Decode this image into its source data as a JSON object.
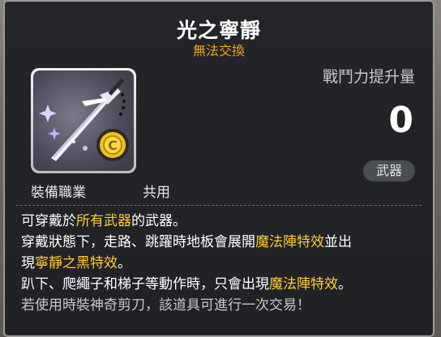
{
  "item": {
    "name": "光之寧靜",
    "trade_status": "無法交換",
    "power_label": "戰鬥力提升量",
    "power_value": "0",
    "category": "武器",
    "job_label": "裝備職業",
    "job_value": "共用",
    "icon": "sword-icon"
  },
  "description": {
    "line1": [
      {
        "text": "可穿戴於",
        "hl": false
      },
      {
        "text": "所有武器",
        "hl": true
      },
      {
        "text": "的武器。",
        "hl": false
      }
    ],
    "line2": [
      {
        "text": "穿戴狀態下，走路、跳躍時地板會展開",
        "hl": false
      },
      {
        "text": "魔法陣特效",
        "hl": true
      },
      {
        "text": "並出",
        "hl": false
      }
    ],
    "line3": [
      {
        "text": "現",
        "hl": false
      },
      {
        "text": "寧靜之黑特效",
        "hl": true
      },
      {
        "text": "。",
        "hl": false
      }
    ],
    "line4": [
      {
        "text": "趴下、爬繩子和梯子等動作時，只會出現",
        "hl": false
      },
      {
        "text": "魔法陣特效",
        "hl": true
      },
      {
        "text": "。",
        "hl": false
      }
    ],
    "note": "若使用時裝神奇剪刀，該道具可進行一次交易！"
  },
  "colors": {
    "highlight": "#ffcc33",
    "subtitle": "#f0a020",
    "panel": "#1c1e22"
  }
}
